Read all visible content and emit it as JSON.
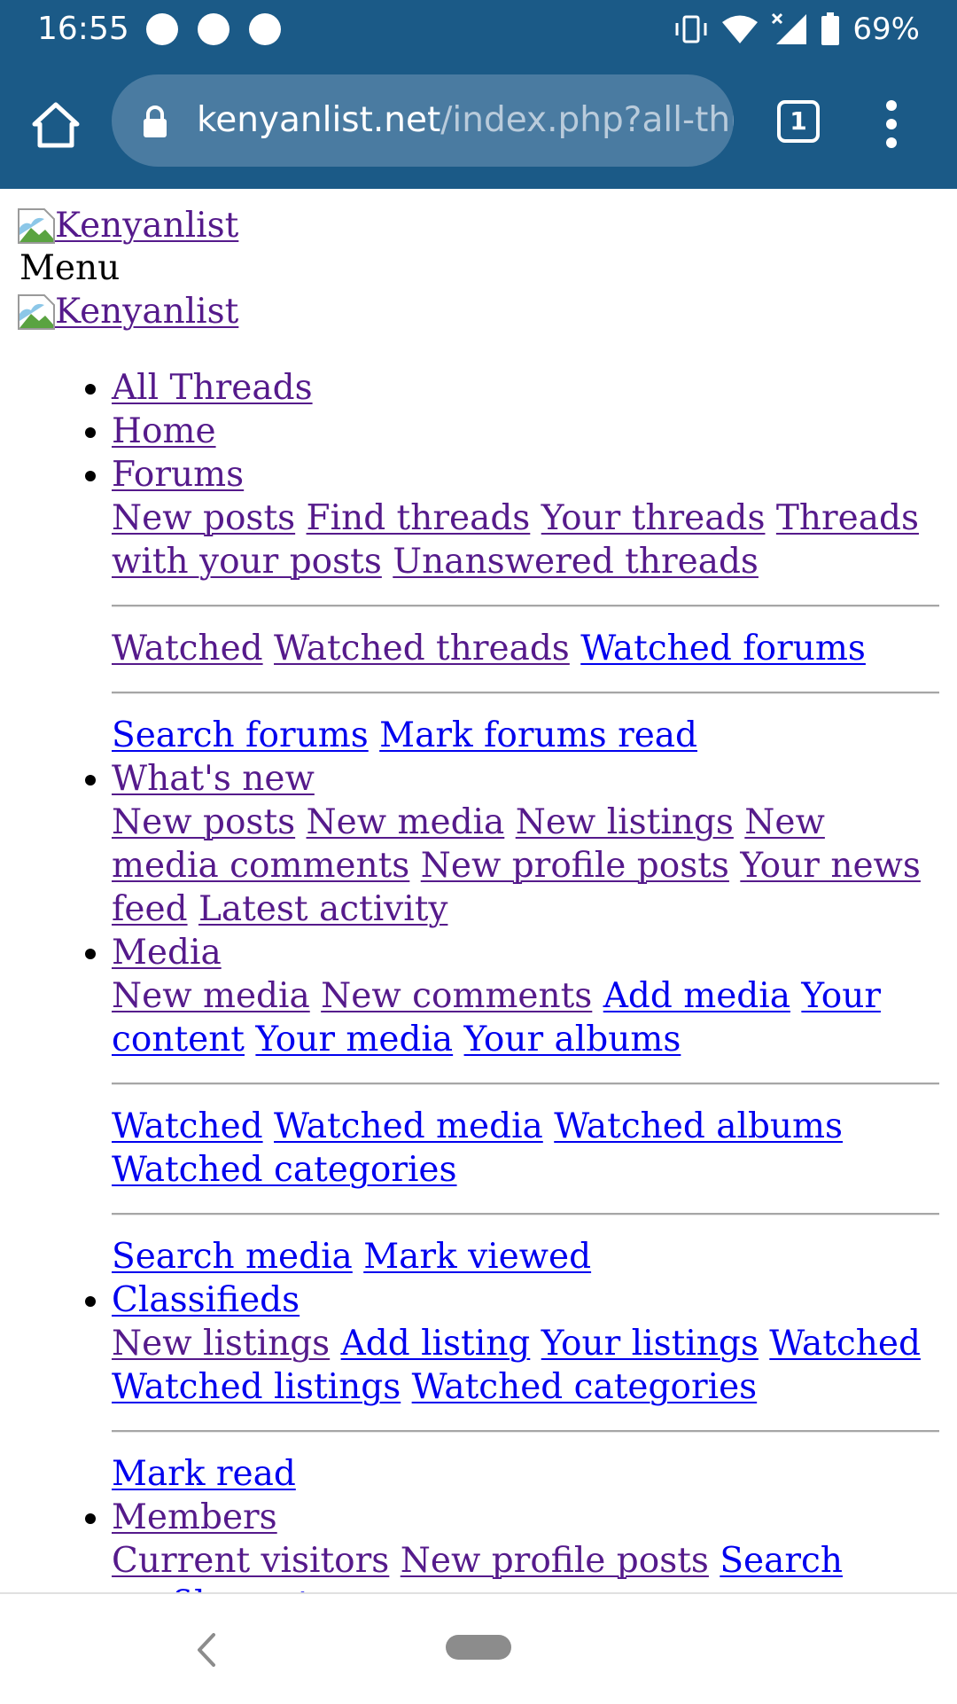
{
  "status": {
    "time": "16:55",
    "battery": "69%"
  },
  "browser": {
    "url_domain": "kenyanlist.net",
    "url_path": "/index.php?all-thr",
    "tab_count": "1"
  },
  "page": {
    "logo_alt": "Kenyanlist",
    "menu_label": "Menu",
    "nav": {
      "all_threads": "All Threads",
      "home": "Home",
      "forums": {
        "label": "Forums",
        "new_posts": "New posts",
        "find_threads": "Find threads",
        "your_threads": "Your threads",
        "threads_with_posts": "Threads with your posts",
        "unanswered": "Unanswered threads",
        "watched": "Watched",
        "watched_threads": "Watched threads",
        "watched_forums": "Watched forums",
        "search_forums": "Search forums",
        "mark_read": "Mark forums read"
      },
      "whats_new": {
        "label": "What's new",
        "new_posts": "New posts",
        "new_media": "New media",
        "new_listings": "New listings",
        "new_media_comments": "New media comments",
        "new_profile_posts": "New profile posts",
        "news_feed": "Your news feed",
        "latest_activity": "Latest activity"
      },
      "media": {
        "label": "Media",
        "new_media": "New media",
        "new_comments": "New comments",
        "add_media": "Add media",
        "your_content": "Your content",
        "your_media": "Your media",
        "your_albums": "Your albums",
        "watched": "Watched",
        "watched_media": "Watched media",
        "watched_albums": "Watched albums",
        "watched_categories": "Watched categories",
        "search_media": "Search media",
        "mark_viewed": "Mark viewed"
      },
      "classifieds": {
        "label": "Classifieds",
        "new_listings": "New listings",
        "add_listing": "Add listing",
        "your_listings": "Your listings",
        "watched": "Watched",
        "watched_listings": "Watched listings",
        "watched_categories": "Watched categories",
        "mark_read": "Mark read"
      },
      "members": {
        "label": "Members",
        "current_visitors": "Current visitors",
        "new_profile_posts": "New profile posts",
        "search_profile_posts": "Search profile posts"
      }
    }
  },
  "colors": {
    "chrome": "#1b5a87",
    "visited_link": "#551a8b",
    "link": "#0000ee"
  }
}
